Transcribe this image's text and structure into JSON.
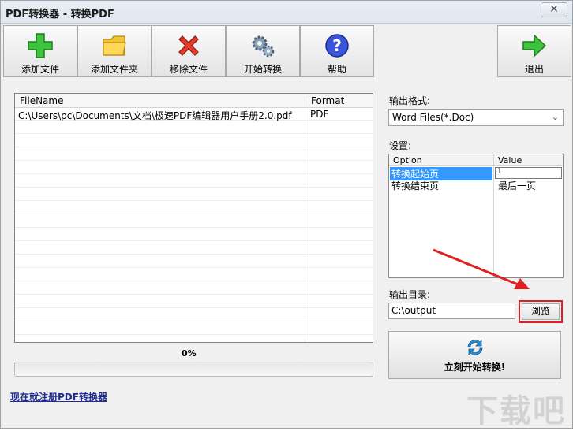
{
  "window": {
    "title": "PDF转换器 - 转换PDF",
    "close_glyph": "✕"
  },
  "toolbar": {
    "add_file": "添加文件",
    "add_folder": "添加文件夹",
    "remove_file": "移除文件",
    "start_convert": "开始转换",
    "help": "帮助",
    "exit": "退出"
  },
  "file_list": {
    "col_filename": "FileName",
    "col_format": "Format",
    "rows": [
      {
        "filename": "C:\\Users\\pc\\Documents\\文档\\极速PDF编辑器用户手册2.0.pdf",
        "format": "PDF"
      }
    ]
  },
  "progress": {
    "label": "0%",
    "value": 0
  },
  "register_link": "现在就注册PDF转换器",
  "output_format": {
    "label": "输出格式:",
    "selected": "Word Files(*.Doc)"
  },
  "settings": {
    "label": "设置:",
    "col_option": "Option",
    "col_value": "Value",
    "rows": [
      {
        "option": "转换起始页",
        "value": "1"
      },
      {
        "option": "转换结束页",
        "value": "最后一页"
      }
    ]
  },
  "output_dir": {
    "label": "输出目录:",
    "value": "C:\\output",
    "browse": "浏览"
  },
  "start_button": "立刻开始转换!",
  "watermark": "下载吧",
  "colors": {
    "highlight": "#e02020",
    "selection": "#3399ff",
    "link": "#1d2c8c"
  }
}
